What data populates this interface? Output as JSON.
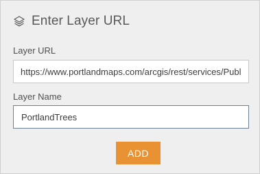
{
  "dialog": {
    "title": "Enter Layer URL",
    "icon": "layers-icon"
  },
  "layer_url": {
    "label": "Layer URL",
    "value": "https://www.portlandmaps.com/arcgis/rest/services/Public/"
  },
  "layer_name": {
    "label": "Layer Name",
    "value": "PortlandTrees"
  },
  "add_button": {
    "label": "ADD",
    "color": "#e99234"
  }
}
